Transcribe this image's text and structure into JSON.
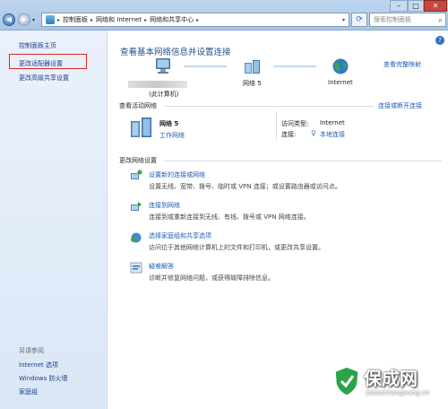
{
  "window": {
    "breadcrumb": [
      "控制面板",
      "网络和 Internet",
      "网络和共享中心"
    ],
    "search_placeholder": "搜索控制面板",
    "controls": [
      "–",
      "□",
      "✕"
    ]
  },
  "sidebar": {
    "items": [
      {
        "label": "控制面板主页"
      },
      {
        "label": "更改适配器设置"
      },
      {
        "label": "更改高级共享设置"
      }
    ],
    "see_also_title": "另请参阅",
    "see_also": [
      {
        "label": "Internet 选项"
      },
      {
        "label": "Windows 防火墙"
      },
      {
        "label": "家庭组"
      }
    ]
  },
  "main": {
    "title": "查看基本网络信息并设置连接",
    "full_map_link": "查看完整映射",
    "map": {
      "computer_label": "(此计算机)",
      "network_label": "网络  5",
      "internet_label": "Internet"
    },
    "active": {
      "title": "查看活动网络",
      "connect_link": "连接或断开连接",
      "network_name": "网络  5",
      "network_type": "工作网络",
      "access_type_label": "访问类型:",
      "access_type_value": "Internet",
      "connection_label": "连接:",
      "connection_value": "本地连接"
    },
    "change_title": "更改网络设置",
    "tasks": [
      {
        "link": "设置新的连接或网络",
        "desc": "设置无线、宽带、拨号、临时或 VPN 连接；或设置路由器或访问点。"
      },
      {
        "link": "连接到网络",
        "desc": "连接到或重新连接到无线、有线、拨号或 VPN 网络连接。"
      },
      {
        "link": "选择家庭组和共享选项",
        "desc": "访问位于其他网络计算机上的文件和打印机，或更改共享设置。"
      },
      {
        "link": "疑难解答",
        "desc": "诊断并修复网络问题，或获得故障排除信息。"
      }
    ]
  },
  "watermark": {
    "text": "保成网",
    "url": "zsbaochengwang.cn"
  }
}
